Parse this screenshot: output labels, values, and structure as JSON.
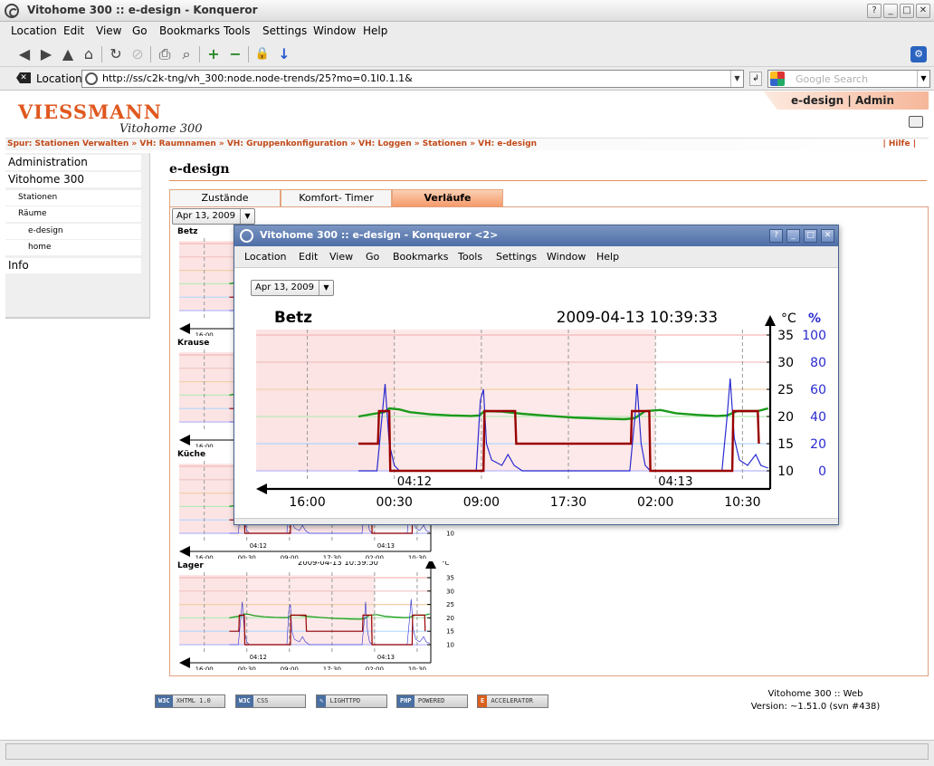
{
  "window": {
    "title": "Vitohome 300 :: e-design - Konqueror",
    "buttons": {
      "help": "?",
      "minimize": "_",
      "maximize": "□",
      "close": "✕"
    }
  },
  "menu": [
    "Location",
    "Edit",
    "View",
    "Go",
    "Bookmarks",
    "Tools",
    "Settings",
    "Window",
    "Help"
  ],
  "toolbar": {
    "icons": [
      "back-icon",
      "forward-icon",
      "up-icon",
      "home-icon",
      "reload-icon",
      "stop-icon",
      "print-icon",
      "find-icon",
      "zoom-in-icon",
      "zoom-out-icon",
      "security-icon",
      "download-icon"
    ],
    "glyphs": [
      "◀",
      "▶",
      "▲",
      "⌂",
      "↻",
      "⊘",
      "⎙",
      "⌕",
      "+",
      "−",
      "🔒",
      "↓"
    ]
  },
  "location": {
    "label": "Location:",
    "url": "http://ss/c2k-tng/vh_300:node.node-trends/25?mo=0.1l0.1.1&",
    "search_placeholder": "Google Search"
  },
  "site": {
    "brand": "VIESSMANN",
    "product": "Vitohome 300",
    "admin_tab": "e-design | Admin",
    "breadcrumb": "Spur: Stationen Verwalten » VH: Raumnamen » VH: Gruppenkonfiguration » VH: Loggen » Stationen » VH: e-design",
    "help": "| Hilfe |"
  },
  "sidebar": {
    "items": [
      {
        "label": "Administration"
      },
      {
        "label": "Vitohome 300"
      },
      {
        "label": "Stationen"
      },
      {
        "label": "Räume"
      },
      {
        "label": "e-design"
      },
      {
        "label": "home"
      },
      {
        "label": "Info"
      }
    ]
  },
  "content": {
    "title": "e-design",
    "tabs": [
      "Zustände",
      "Komfort- Timer",
      "Verläufe"
    ],
    "active_tab": 2,
    "date_select": "Apr 13, 2009"
  },
  "mini_charts": [
    {
      "name": "Betz"
    },
    {
      "name": "Krause"
    },
    {
      "name": "Küche"
    },
    {
      "name": "Lager",
      "timestamp": "2009-04-13 10:39:50"
    }
  ],
  "footer": {
    "badges": [
      {
        "logo": "W3C",
        "text": "XHTML 1.0"
      },
      {
        "logo": "W3C",
        "text": "CSS"
      },
      {
        "logo": "✎",
        "text": "LIGHTTPD"
      },
      {
        "logo": "PHP",
        "text": "POWERED"
      },
      {
        "logo": "E",
        "text": "ACCELERATOR"
      }
    ],
    "version_line1": "Vitohome 300 :: Web",
    "version_line2": "Version: ~1.51.0 (svn #438)"
  },
  "popup": {
    "title": "Vitohome 300 :: e-design - Konqueror <2>",
    "date_select": "Apr 13, 2009"
  },
  "colors": {
    "accent": "#e0581e",
    "temp_line": "#1a9a1a",
    "humidity_line": "#2a2ad0",
    "setpoint_line": "#990000",
    "night_band": "#fde4e4"
  },
  "chart_data": {
    "type": "line",
    "title": "Betz",
    "timestamp": "2009-04-13 10:39:33",
    "y_left_unit": "°C",
    "y_right_unit": "%",
    "ylim": [
      10,
      35
    ],
    "y_ticks": [
      10,
      15,
      20,
      25,
      30,
      35
    ],
    "y2_ticks": [
      0,
      20,
      40,
      60,
      80,
      100
    ],
    "x_ticks": [
      "16:00",
      "00:30",
      "09:00",
      "17:30",
      "02:00",
      "10:30"
    ],
    "x_hours": [
      0,
      8.5,
      17,
      25.5,
      34,
      42.5
    ],
    "date_labels": [
      {
        "text": "04:12",
        "hour": 8.5
      },
      {
        "text": "04:13",
        "hour": 34
      }
    ],
    "series": [
      {
        "color": "#1a9a1a",
        "points": [
          [
            5,
            20
          ],
          [
            6.5,
            20.5
          ],
          [
            7.5,
            20.8
          ],
          [
            8,
            21.5
          ],
          [
            9,
            21.3
          ],
          [
            10,
            20.8
          ],
          [
            12,
            20.4
          ],
          [
            14,
            20.2
          ],
          [
            16,
            20.1
          ],
          [
            16.8,
            20.2
          ],
          [
            17.3,
            21
          ],
          [
            19,
            20.9
          ],
          [
            21,
            20.5
          ],
          [
            23,
            20.2
          ],
          [
            26,
            19.8
          ],
          [
            29,
            19.6
          ],
          [
            31,
            19.5
          ],
          [
            32,
            19.7
          ],
          [
            33,
            21
          ],
          [
            34.5,
            21.2
          ],
          [
            36,
            20.6
          ],
          [
            38,
            20.3
          ],
          [
            40,
            20.1
          ],
          [
            41,
            20.2
          ],
          [
            42,
            21
          ],
          [
            44,
            21
          ],
          [
            45,
            21.5
          ]
        ]
      },
      {
        "color": "#2a2ad0",
        "points": [
          [
            5,
            10
          ],
          [
            6.8,
            10
          ],
          [
            7.2,
            18
          ],
          [
            7.6,
            26
          ],
          [
            8,
            15
          ],
          [
            8.5,
            11
          ],
          [
            9,
            10
          ],
          [
            16.5,
            10
          ],
          [
            16.9,
            23
          ],
          [
            17.2,
            25
          ],
          [
            17.5,
            15
          ],
          [
            18,
            12
          ],
          [
            19,
            11
          ],
          [
            19.6,
            13
          ],
          [
            20.2,
            11
          ],
          [
            21,
            10
          ],
          [
            31.5,
            10
          ],
          [
            32,
            20
          ],
          [
            32.2,
            26
          ],
          [
            32.6,
            15
          ],
          [
            33,
            11
          ],
          [
            33.5,
            10
          ],
          [
            40.5,
            10
          ],
          [
            41,
            20
          ],
          [
            41.3,
            27
          ],
          [
            41.7,
            16
          ],
          [
            42.2,
            12
          ],
          [
            43,
            11
          ],
          [
            43.8,
            13
          ],
          [
            44.3,
            11
          ],
          [
            45,
            10.5
          ]
        ]
      },
      {
        "color": "#990000",
        "points": [
          [
            5,
            15
          ],
          [
            6.9,
            15
          ],
          [
            7,
            21
          ],
          [
            8,
            21
          ],
          [
            8.1,
            10
          ],
          [
            17.2,
            10
          ],
          [
            17.3,
            21
          ],
          [
            20.3,
            21
          ],
          [
            20.4,
            15
          ],
          [
            31.6,
            15
          ],
          [
            31.7,
            21
          ],
          [
            33.4,
            21
          ],
          [
            33.5,
            10
          ],
          [
            41.5,
            10
          ],
          [
            41.6,
            21
          ],
          [
            44,
            21
          ],
          [
            44.1,
            15
          ]
        ]
      }
    ]
  }
}
